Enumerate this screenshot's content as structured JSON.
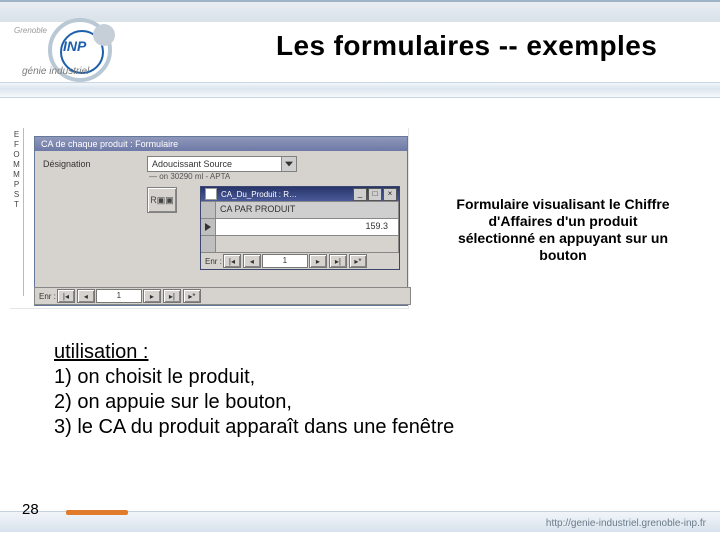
{
  "logo": {
    "top_text": "Grenoble",
    "inp": "INP",
    "sub": "génie industriel"
  },
  "title": "Les formulaires -- exemples",
  "shot": {
    "leftcol_letters": [
      "E",
      "F",
      "O",
      "M",
      "M",
      "P",
      "S",
      "T"
    ],
    "win1_title": "CA de chaque produit : Formulaire",
    "field_label": "Désignation",
    "combo_value": "Adoucissant Source",
    "combo_sub": "— on 30290 ml - APTA",
    "button_text": "R▣▣",
    "win2_title": "CA_Du_Produit : R…",
    "header_cell": "CA PAR PRODUIT",
    "value": "159.3",
    "nav_label": "Enr :",
    "nav_count": "1",
    "min": "_",
    "max": "□",
    "close": "×"
  },
  "caption": {
    "l1": "Formulaire visualisant le Chiffre",
    "l2": "d'Affaires d'un produit",
    "l3": "sélectionné en appuyant sur un",
    "l4": "bouton"
  },
  "usage": {
    "heading": "utilisation :",
    "s1": "1) on choisit le produit,",
    "s2": "2) on appuie sur le bouton,",
    "s3": "3) le CA du produit apparaît dans une fenêtre"
  },
  "page_number": "28",
  "footer_url": "http://genie-industriel.grenoble-inp.fr"
}
